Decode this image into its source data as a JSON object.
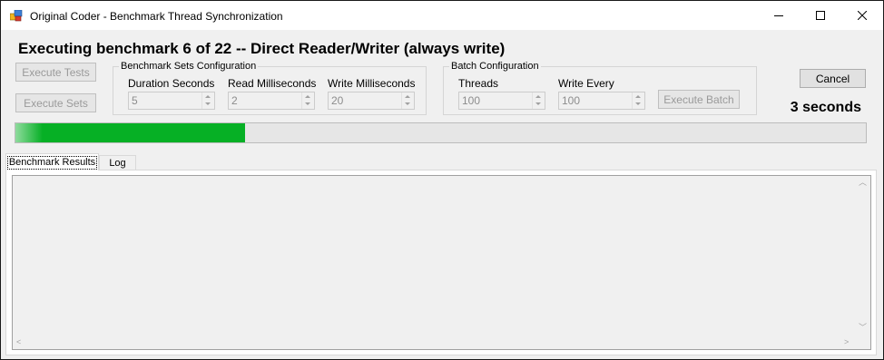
{
  "window": {
    "title": "Original Coder - Benchmark Thread Synchronization",
    "icon": "app-icon",
    "controls": [
      "minimize-icon",
      "maximize-icon",
      "close-icon"
    ]
  },
  "header": {
    "status": "Executing benchmark 6 of 22 -- Direct Reader/Writer (always write)",
    "elapsed": "3 seconds"
  },
  "buttons": {
    "execute_tests": "Execute Tests",
    "execute_sets": "Execute Sets",
    "execute_batch": "Execute Batch",
    "cancel": "Cancel"
  },
  "benchmark_sets": {
    "title": "Benchmark Sets Configuration",
    "duration_label": "Duration Seconds",
    "duration_value": "5",
    "read_label": "Read Milliseconds",
    "read_value": "2",
    "write_label": "Write Milliseconds",
    "write_value": "20"
  },
  "batch": {
    "title": "Batch Configuration",
    "threads_label": "Threads",
    "threads_value": "100",
    "write_every_label": "Write Every",
    "write_every_value": "100"
  },
  "progress": {
    "fraction": 0.27,
    "color": "#06b025"
  },
  "tabs": [
    {
      "label": "Benchmark Results",
      "selected": true
    },
    {
      "label": "Log",
      "selected": false
    }
  ]
}
